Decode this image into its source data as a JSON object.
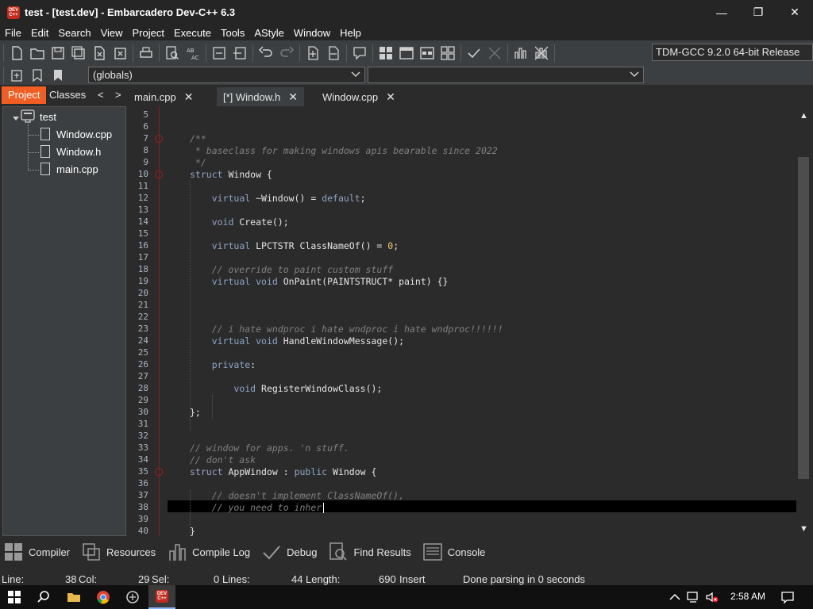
{
  "window": {
    "title": "test - [test.dev] - Embarcadero Dev-C++ 6.3",
    "icon_label": "DEV C++",
    "minimize": "—",
    "restore": "❐",
    "close": "✕"
  },
  "menu": [
    "File",
    "Edit",
    "Search",
    "View",
    "Project",
    "Execute",
    "Tools",
    "AStyle",
    "Window",
    "Help"
  ],
  "toolbar": {
    "compiler": "TDM-GCC 9.2.0 64-bit Release",
    "scope_combo": "(globals)",
    "member_combo": ""
  },
  "left_tabs": {
    "project": "Project",
    "classes": "Classes",
    "prev": "<",
    "next": ">"
  },
  "file_tabs": [
    {
      "label": "main.cpp",
      "close": "✕"
    },
    {
      "label": "[*] Window.h",
      "close": "✕"
    },
    {
      "label": "Window.cpp",
      "close": "✕"
    }
  ],
  "project_tree": {
    "root": "test",
    "files": [
      "Window.cpp",
      "Window.h",
      "main.cpp"
    ]
  },
  "editor": {
    "lines": [
      {
        "n": "5",
        "text": ""
      },
      {
        "n": "6",
        "text": ""
      },
      {
        "n": "7",
        "text": "/**",
        "kind": "comment"
      },
      {
        "n": "8",
        "text": " * baseclass for making windows apis bearable since 2022",
        "kind": "comment"
      },
      {
        "n": "9",
        "text": " */",
        "kind": "comment"
      },
      {
        "n": "10",
        "text": "struct Window {"
      },
      {
        "n": "11",
        "text": ""
      },
      {
        "n": "12",
        "text": "    virtual ~Window() = default;"
      },
      {
        "n": "13",
        "text": ""
      },
      {
        "n": "14",
        "text": "    void Create();"
      },
      {
        "n": "15",
        "text": ""
      },
      {
        "n": "16",
        "text": "    virtual LPCTSTR ClassNameOf() = 0;"
      },
      {
        "n": "17",
        "text": ""
      },
      {
        "n": "18",
        "text": "    // override to paint custom stuff",
        "kind": "comment"
      },
      {
        "n": "19",
        "text": "    virtual void OnPaint(PAINTSTRUCT* paint) {}"
      },
      {
        "n": "20",
        "text": ""
      },
      {
        "n": "21",
        "text": ""
      },
      {
        "n": "22",
        "text": ""
      },
      {
        "n": "23",
        "text": "    // i hate wndproc i hate wndproc i hate wndproc!!!!!!",
        "kind": "comment"
      },
      {
        "n": "24",
        "text": "    virtual void HandleWindowMessage();"
      },
      {
        "n": "25",
        "text": ""
      },
      {
        "n": "26",
        "text": "    private:"
      },
      {
        "n": "27",
        "text": ""
      },
      {
        "n": "28",
        "text": "        void RegisterWindowClass();"
      },
      {
        "n": "29",
        "text": ""
      },
      {
        "n": "30",
        "text": "};"
      },
      {
        "n": "31",
        "text": ""
      },
      {
        "n": "32",
        "text": ""
      },
      {
        "n": "33",
        "text": "// window for apps. 'n stuff.",
        "kind": "comment"
      },
      {
        "n": "34",
        "text": "// don't ask",
        "kind": "comment"
      },
      {
        "n": "35",
        "text": "struct AppWindow : public Window {"
      },
      {
        "n": "36",
        "text": ""
      },
      {
        "n": "37",
        "text": "    // doesn't implement ClassNameOf(),",
        "kind": "comment"
      },
      {
        "n": "38",
        "text": "    // you need to inher",
        "kind": "comment"
      },
      {
        "n": "39",
        "text": ""
      },
      {
        "n": "40",
        "text": "}"
      }
    ]
  },
  "bottom_tabs": [
    "Compiler",
    "Resources",
    "Compile Log",
    "Debug",
    "Find Results",
    "Console"
  ],
  "status": {
    "line_label": "Line:",
    "line_value": "38",
    "col_label": "Col:",
    "col_value": "29",
    "sel_label": "Sel:",
    "sel_value": "0",
    "lines_label": "Lines:",
    "lines_value": "44",
    "length_label": "Length:",
    "length_value": "690",
    "mode": "Insert",
    "message": "Done parsing in 0 seconds"
  },
  "taskbar": {
    "time": "2:58 AM"
  },
  "colors": {
    "accent": "#f05e23",
    "background": "#2b2b2b",
    "panel": "#3c3f41"
  }
}
